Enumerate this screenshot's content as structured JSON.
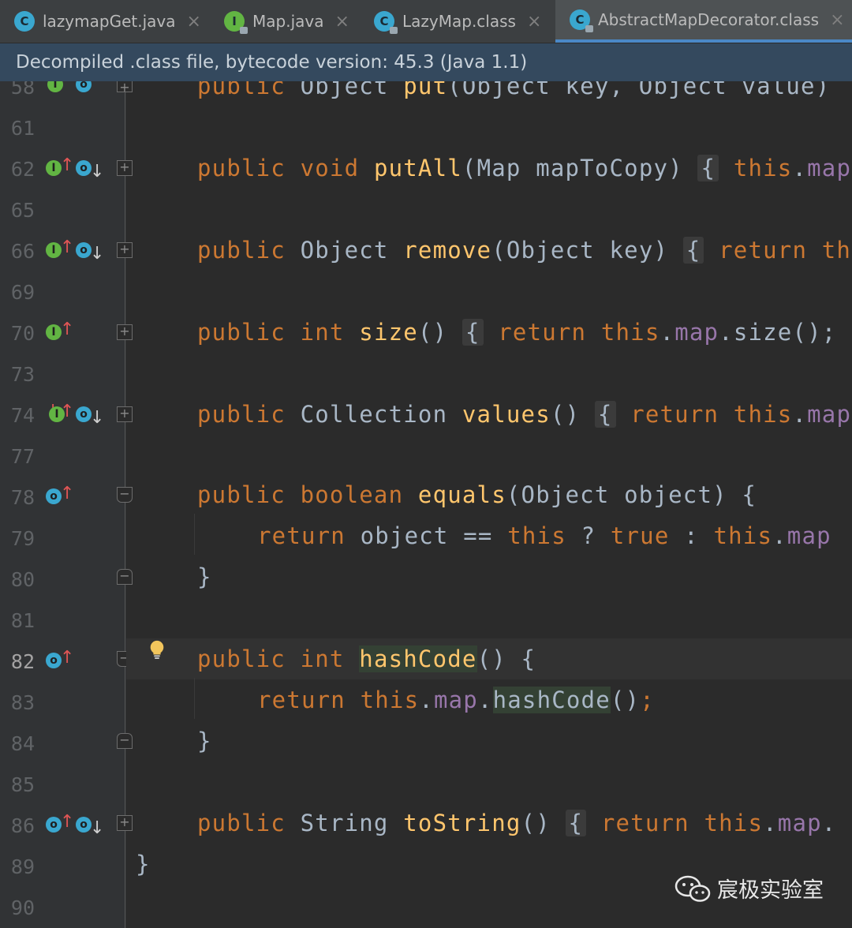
{
  "tabs": [
    {
      "label": "lazymapGet.java",
      "icon": "class-icon",
      "icon_letter": "C",
      "active": false
    },
    {
      "label": "Map.java",
      "icon": "interface-icon",
      "icon_letter": "I",
      "active": false
    },
    {
      "label": "LazyMap.class",
      "icon": "class-icon",
      "icon_letter": "C",
      "active": false
    },
    {
      "label": "AbstractMapDecorator.class",
      "icon": "class-icon",
      "icon_letter": "C",
      "active": true
    }
  ],
  "tab_close_glyph": "×",
  "banner": {
    "text": "Decompiled .class file, bytecode version: 45.3 (Java 1.1)"
  },
  "line_numbers": [
    "58",
    "61",
    "62",
    "65",
    "66",
    "69",
    "70",
    "73",
    "74",
    "77",
    "78",
    "79",
    "80",
    "81",
    "82",
    "83",
    "84",
    "85",
    "86",
    "89",
    "90"
  ],
  "current_line": "82",
  "gutter_letters": {
    "implemented": "I",
    "overriding": "o"
  },
  "watermark": {
    "text": "宸极实验室"
  },
  "colors": {
    "keyword": "#cc7832",
    "method": "#ffc66d",
    "field": "#9876aa",
    "text": "#a9b7c6",
    "banner_bg": "#34495e",
    "editor_bg": "#2b2b2b"
  }
}
